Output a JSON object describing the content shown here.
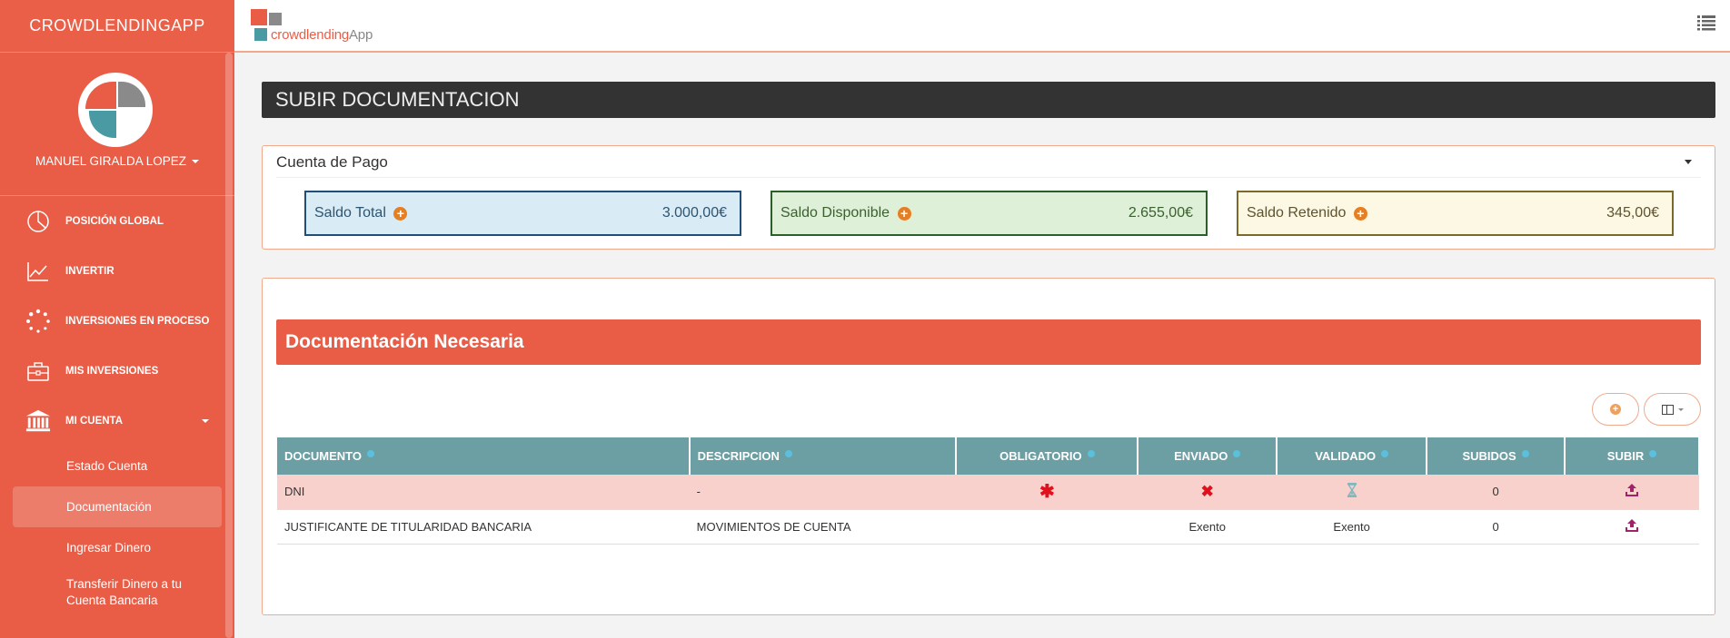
{
  "sidebar": {
    "brand": "CROWDLENDINGAPP",
    "username": "MANUEL GIRALDA LOPEZ",
    "nav": [
      {
        "label": "POSICIÓN GLOBAL",
        "icon": "pie-chart-icon"
      },
      {
        "label": "INVERTIR",
        "icon": "line-chart-icon"
      },
      {
        "label": "INVERSIONES EN PROCESO",
        "icon": "spinner-icon"
      },
      {
        "label": "MIS INVERSIONES",
        "icon": "briefcase-icon"
      },
      {
        "label": "MI CUENTA",
        "icon": "bank-icon"
      }
    ],
    "sub": [
      {
        "label": "Estado Cuenta"
      },
      {
        "label": "Documentación",
        "active": true
      },
      {
        "label": "Ingresar Dinero"
      },
      {
        "label": "Transferir Dinero a tu Cuenta Bancaria"
      }
    ]
  },
  "topbar": {
    "logo_part1": "crowdlending",
    "logo_part2": "App",
    "colors": {
      "red": "#e95d47",
      "grey": "#8a8a8a",
      "teal": "#4a9aa4"
    }
  },
  "page": {
    "title": "SUBIR DOCUMENTACION"
  },
  "cuenta": {
    "label": "Cuenta de Pago",
    "saldos": [
      {
        "label": "Saldo Total",
        "value": "3.000,00€"
      },
      {
        "label": "Saldo Disponible",
        "value": "2.655,00€"
      },
      {
        "label": "Saldo Retenido",
        "value": "345,00€"
      }
    ]
  },
  "docs": {
    "header": "Documentación Necesaria",
    "columns": [
      "DOCUMENTO",
      "DESCRIPCION",
      "OBLIGATORIO",
      "ENVIADO",
      "VALIDADO",
      "SUBIDOS",
      "SUBIR"
    ],
    "rows": [
      {
        "documento": "DNI",
        "descripcion": "-",
        "obligatorio": "required-icon",
        "enviado": "cross-icon",
        "validado": "hourglass-icon",
        "subidos": "0",
        "subir": "upload-icon"
      },
      {
        "documento": "JUSTIFICANTE DE TITULARIDAD BANCARIA",
        "descripcion": "MOVIMIENTOS DE CUENTA",
        "obligatorio": "",
        "enviado": "Exento",
        "validado": "Exento",
        "subidos": "0",
        "subir": "upload-icon"
      }
    ]
  }
}
